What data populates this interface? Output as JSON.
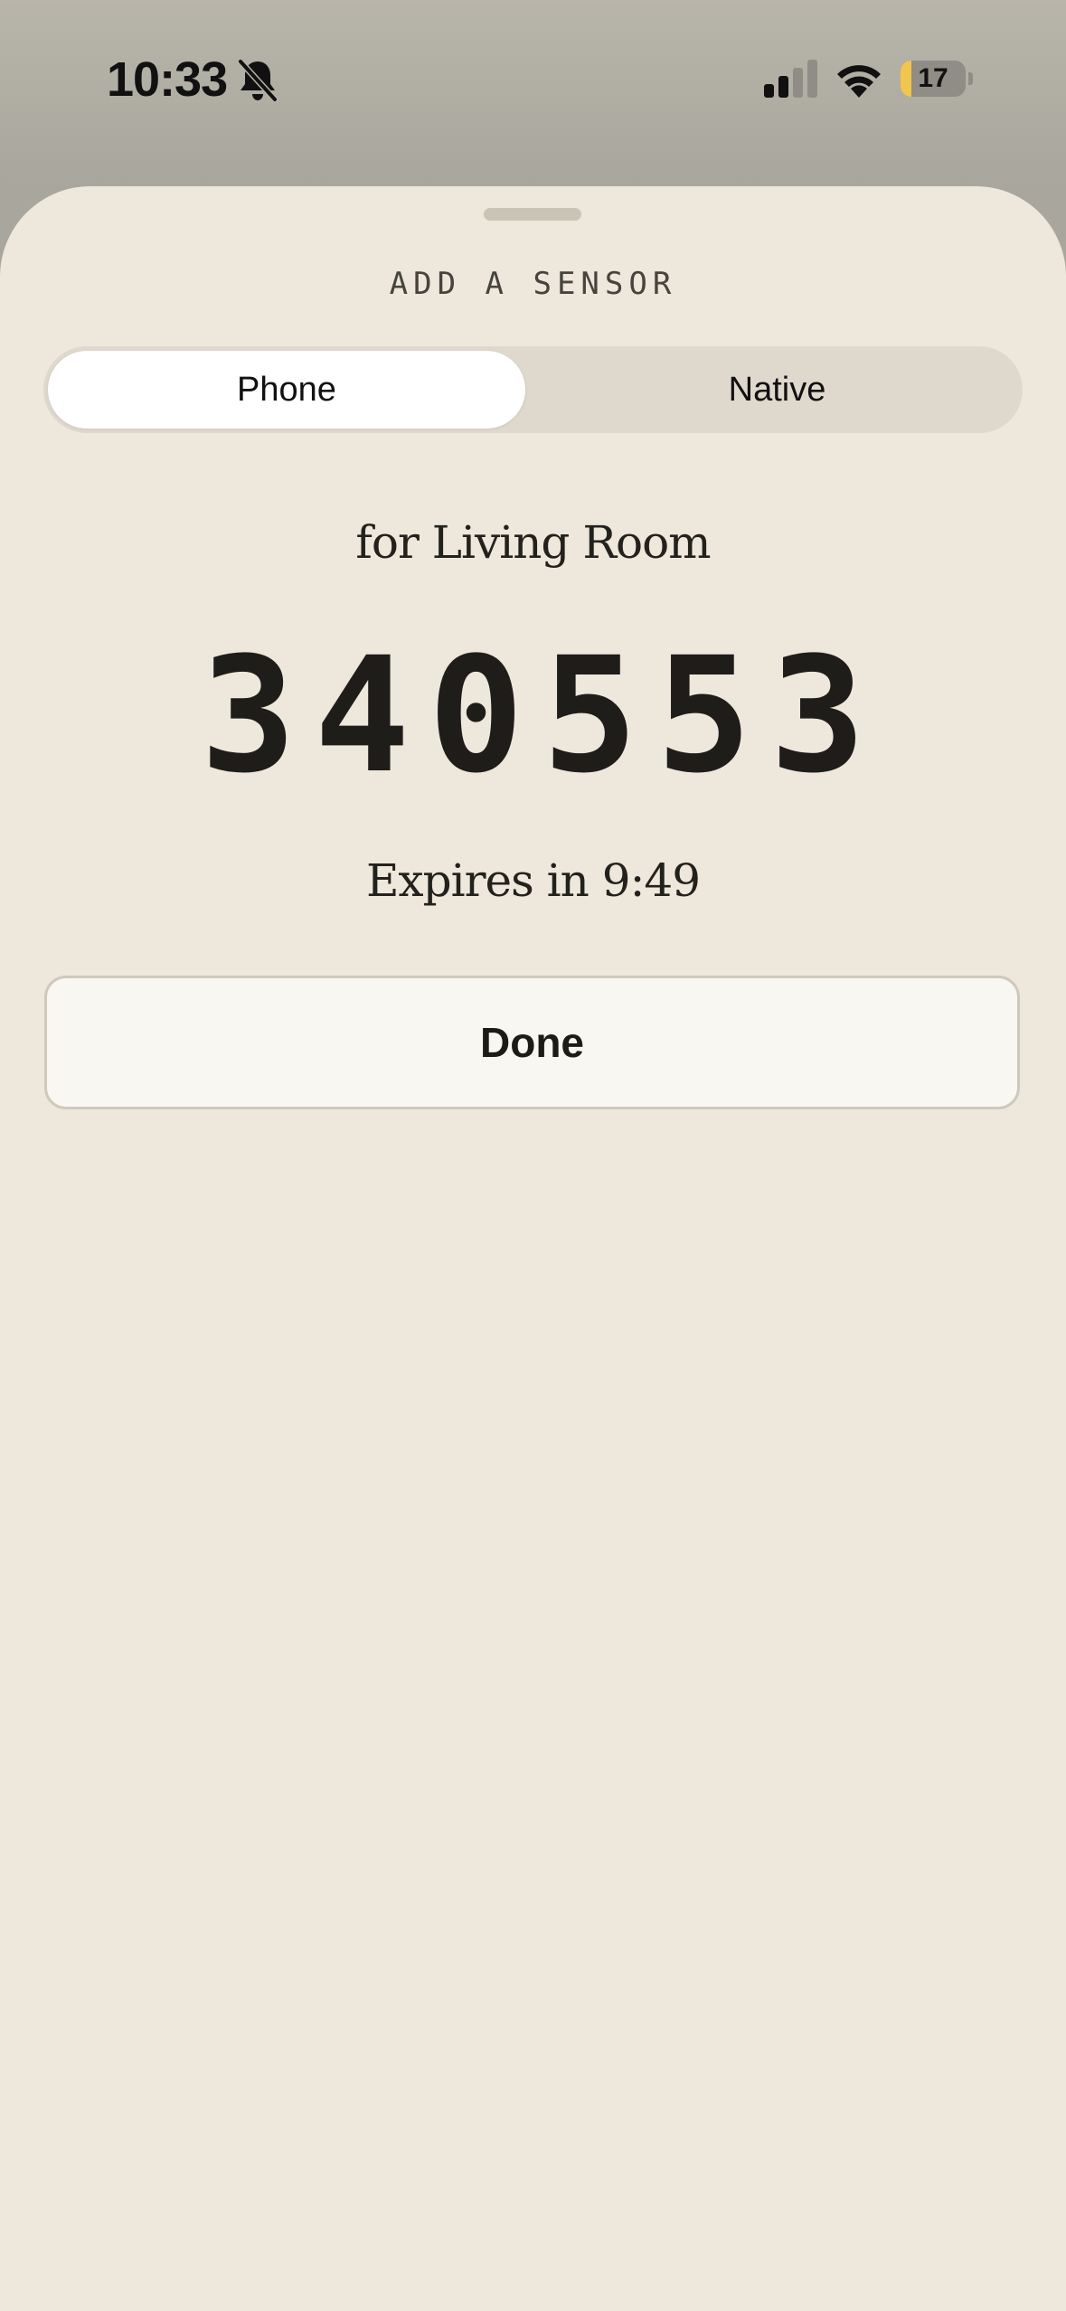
{
  "status_bar": {
    "time": "10:33",
    "silent_icon": "bell-slash-icon",
    "signal_icon": "cellular-signal-icon",
    "wifi_icon": "wifi-icon",
    "battery_level": "17",
    "battery_fraction": 0.17,
    "battery_fill_color": "#f2c64a"
  },
  "sheet": {
    "title": "ADD A SENSOR",
    "tabs": [
      {
        "label": "Phone",
        "selected": true
      },
      {
        "label": "Native",
        "selected": false
      }
    ],
    "room_label": "for Living Room",
    "code": "340553",
    "expires_text": "Expires in 9:49",
    "done_label": "Done"
  },
  "colors": {
    "sheet_background": "#ede7dc",
    "segment_track": "#ded8cd",
    "segment_active": "#ffffff",
    "button_background": "#f9f7f1",
    "text_primary": "#1e1d1a"
  }
}
